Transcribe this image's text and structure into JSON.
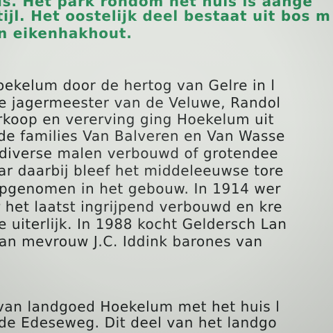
{
  "sign": {
    "green_lines": [
      "is. Het park rondom het huis is aange",
      "stijl. Het oostelijk deel bestaat uit bos m",
      "n eikenhakhout."
    ],
    "body_lines": [
      "oekelum door de hertog van Gelre in l",
      "e jagermeester van de Veluwe, Randol",
      "rkoop en vererving ging Hoekelum uit",
      "de families Van Balveren en Van Wasse",
      "diverse malen verbouwd of grotendee",
      "ar daarbij bleef het middeleeuwse tore",
      "pgenomen in het gebouw. In 1914 wer",
      "r het laatst ingrijpend verbouwd en kre",
      "e uiterlijk. In 1988 kocht Geldersch Lan",
      "an mevrouw J.C. Iddink barones van"
    ],
    "bottom_lines": [
      "van landgoed Hoekelum met het huis l",
      "de Edeseweg. Dit deel van het landgo"
    ]
  },
  "colors": {
    "heading_green": "#2a8a58",
    "body_text": "#1e2222",
    "panel_background": "#dfe2dd"
  }
}
